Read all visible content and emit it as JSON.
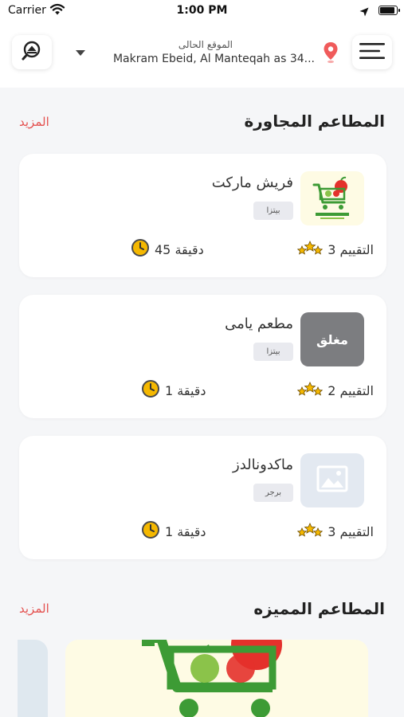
{
  "status_bar": {
    "carrier": "Carrier",
    "time": "1:00 PM"
  },
  "header": {
    "location_label": "الموقع الحالى",
    "location_address": "Makram Ebeid, Al Manteqah as 34..."
  },
  "nearby": {
    "title": "المطاعم المجاورة",
    "more": "المزيد",
    "restaurants": [
      {
        "name": "فريش ماركت",
        "tag": "بيتزا",
        "rating": "3 التقييم",
        "time": "45 دقيقة",
        "thumb": "fresh-market-logo"
      },
      {
        "name": "مطعم يامى",
        "tag": "بيتزا",
        "rating": "2 التقييم",
        "time": "1 دقيقة",
        "thumb": "closed-overlay",
        "closed_label": "مغلق"
      },
      {
        "name": "ماكدونالدز",
        "tag": "برجر",
        "rating": "3 التقييم",
        "time": "1 دقيقة",
        "thumb": "image-placeholder-icon"
      }
    ]
  },
  "featured": {
    "title": "المطاعم المميزه",
    "more": "المزيد"
  },
  "colors": {
    "accent": "#e4514f",
    "background": "#f5f6f8",
    "card": "#ffffff",
    "logo_green": "#3d9b35",
    "logo_red": "#e4312b"
  }
}
